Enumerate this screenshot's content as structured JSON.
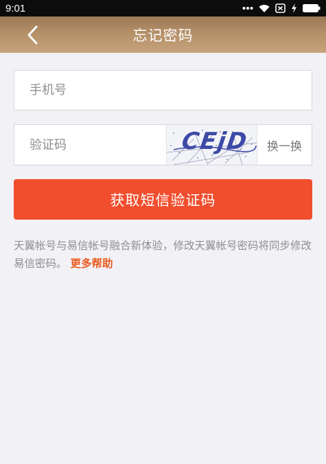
{
  "status_bar": {
    "time": "9:01",
    "icons": [
      "dots-icon",
      "wifi-icon",
      "sim-x-icon",
      "charging-icon",
      "battery-icon"
    ]
  },
  "nav": {
    "back_icon": "chevron-left-icon",
    "title": "忘记密码"
  },
  "form": {
    "phone_placeholder": "手机号",
    "code_placeholder": "验证码",
    "captcha_text": "CEjD",
    "refresh_label": "换一换",
    "submit_label": "获取短信验证码"
  },
  "notice": {
    "text": "天翼帐号与易信帐号融合新体验，修改天翼帐号密码将同步修改易信密码。",
    "help_link": "更多帮助"
  },
  "colors": {
    "nav_gradient_top": "#9b7a57",
    "nav_gradient_bottom": "#c7a37c",
    "accent": "#f14e2e",
    "link": "#ea5a1e",
    "background": "#f2f1f6"
  }
}
